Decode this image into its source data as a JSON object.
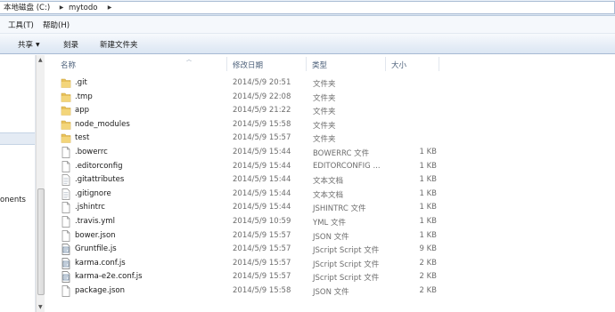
{
  "address": {
    "segments": [
      "本地磁盘 (C:)",
      "mytodo"
    ]
  },
  "menu": {
    "tools": "工具(T)",
    "help": "帮助(H)"
  },
  "commands": {
    "share": "共享",
    "burn": "刻录",
    "new_folder": "新建文件夹"
  },
  "nav": {
    "partial_label": "onents"
  },
  "columns": {
    "name": "名称",
    "date": "修改日期",
    "type": "类型",
    "size": "大小"
  },
  "files": [
    {
      "name": ".git",
      "date": "2014/5/9 20:51",
      "type": "文件夹",
      "size": "",
      "icon": "folder-icon"
    },
    {
      "name": ".tmp",
      "date": "2014/5/9 22:08",
      "type": "文件夹",
      "size": "",
      "icon": "folder-icon"
    },
    {
      "name": "app",
      "date": "2014/5/9 21:22",
      "type": "文件夹",
      "size": "",
      "icon": "folder-icon"
    },
    {
      "name": "node_modules",
      "date": "2014/5/9 15:58",
      "type": "文件夹",
      "size": "",
      "icon": "folder-icon"
    },
    {
      "name": "test",
      "date": "2014/5/9 15:57",
      "type": "文件夹",
      "size": "",
      "icon": "folder-icon"
    },
    {
      "name": ".bowerrc",
      "date": "2014/5/9 15:44",
      "type": "BOWERRC 文件",
      "size": "1 KB",
      "icon": "file-icon"
    },
    {
      "name": ".editorconfig",
      "date": "2014/5/9 15:44",
      "type": "EDITORCONFIG ...",
      "size": "1 KB",
      "icon": "file-icon"
    },
    {
      "name": ".gitattributes",
      "date": "2014/5/9 15:44",
      "type": "文本文档",
      "size": "1 KB",
      "icon": "text-file-icon"
    },
    {
      "name": ".gitignore",
      "date": "2014/5/9 15:44",
      "type": "文本文档",
      "size": "1 KB",
      "icon": "text-file-icon"
    },
    {
      "name": ".jshintrc",
      "date": "2014/5/9 15:44",
      "type": "JSHINTRC 文件",
      "size": "1 KB",
      "icon": "file-icon"
    },
    {
      "name": ".travis.yml",
      "date": "2014/5/9 10:59",
      "type": "YML 文件",
      "size": "1 KB",
      "icon": "file-icon"
    },
    {
      "name": "bower.json",
      "date": "2014/5/9 15:57",
      "type": "JSON 文件",
      "size": "1 KB",
      "icon": "file-icon"
    },
    {
      "name": "Gruntfile.js",
      "date": "2014/5/9 15:57",
      "type": "JScript Script 文件",
      "size": "9 KB",
      "icon": "script-file-icon"
    },
    {
      "name": "karma.conf.js",
      "date": "2014/5/9 15:57",
      "type": "JScript Script 文件",
      "size": "2 KB",
      "icon": "script-file-icon"
    },
    {
      "name": "karma-e2e.conf.js",
      "date": "2014/5/9 15:57",
      "type": "JScript Script 文件",
      "size": "2 KB",
      "icon": "script-file-icon"
    },
    {
      "name": "package.json",
      "date": "2014/5/9 15:58",
      "type": "JSON 文件",
      "size": "2 KB",
      "icon": "file-icon"
    }
  ],
  "colors": {
    "folder": "#e8c15a",
    "header_text": "#4c607a",
    "secondary_text": "#6d6d6d"
  }
}
